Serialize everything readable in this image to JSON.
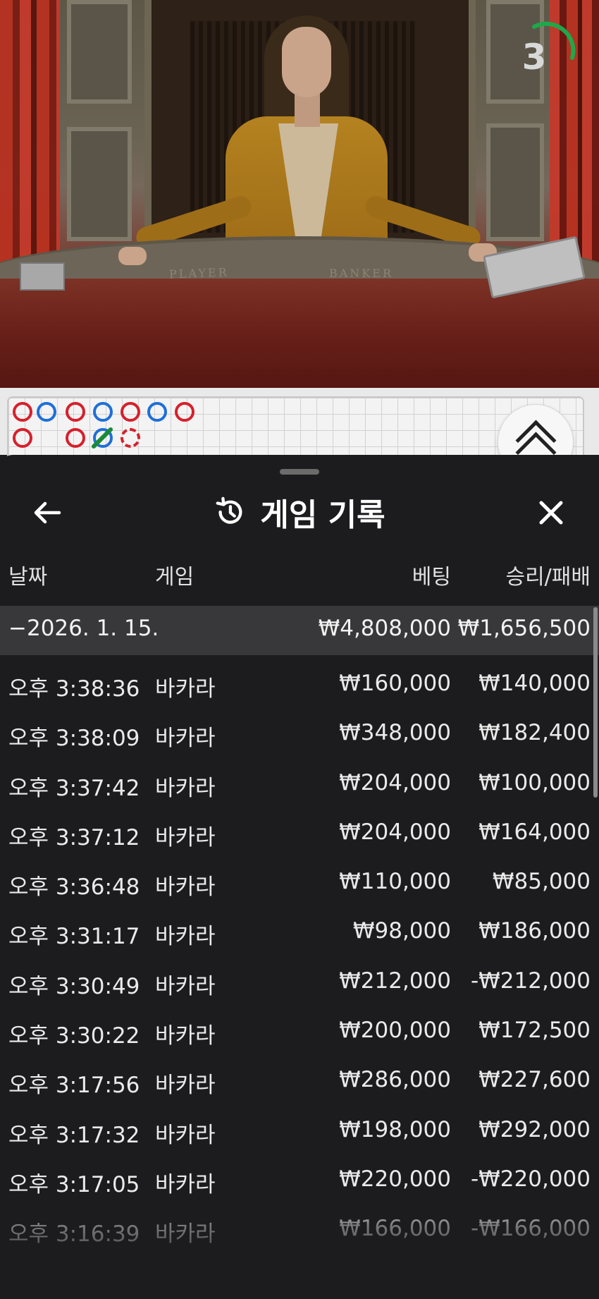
{
  "video": {
    "countdown": "3",
    "table_labels": {
      "player": "PLAYER",
      "banker": "BANKER"
    }
  },
  "roadmap": {
    "expand_icon": "chevron-double-up-icon"
  },
  "sheet": {
    "title": "게임 기록",
    "title_icon": "history-icon",
    "back_icon": "arrow-left-icon",
    "close_icon": "close-icon",
    "columns": {
      "date": "날짜",
      "game": "게임",
      "bet": "베팅",
      "winloss": "승리/패배"
    },
    "day_group": {
      "date": "−2026. 1. 15.",
      "bet_total": "₩4,808,000",
      "winloss_total": "₩1,656,500"
    },
    "rows": [
      {
        "time": "오후 3:38:36",
        "game": "바카라",
        "bet": "₩160,000",
        "winloss": "₩140,000"
      },
      {
        "time": "오후 3:38:09",
        "game": "바카라",
        "bet": "₩348,000",
        "winloss": "₩182,400"
      },
      {
        "time": "오후 3:37:42",
        "game": "바카라",
        "bet": "₩204,000",
        "winloss": "₩100,000"
      },
      {
        "time": "오후 3:37:12",
        "game": "바카라",
        "bet": "₩204,000",
        "winloss": "₩164,000"
      },
      {
        "time": "오후 3:36:48",
        "game": "바카라",
        "bet": "₩110,000",
        "winloss": "₩85,000"
      },
      {
        "time": "오후 3:31:17",
        "game": "바카라",
        "bet": "₩98,000",
        "winloss": "₩186,000"
      },
      {
        "time": "오후 3:30:49",
        "game": "바카라",
        "bet": "₩212,000",
        "winloss": "-₩212,000"
      },
      {
        "time": "오후 3:30:22",
        "game": "바카라",
        "bet": "₩200,000",
        "winloss": "₩172,500"
      },
      {
        "time": "오후 3:17:56",
        "game": "바카라",
        "bet": "₩286,000",
        "winloss": "₩227,600"
      },
      {
        "time": "오후 3:17:32",
        "game": "바카라",
        "bet": "₩198,000",
        "winloss": "₩292,000"
      },
      {
        "time": "오후 3:17:05",
        "game": "바카라",
        "bet": "₩220,000",
        "winloss": "-₩220,000"
      },
      {
        "time": "오후 3:16:39",
        "game": "바카라",
        "bet": "₩166,000",
        "winloss": "-₩166,000"
      }
    ]
  },
  "colors": {
    "banker_red": "#d6202b",
    "player_blue": "#1e6fd8",
    "tie_green": "#1a8a3a",
    "timer_green": "#1ea84a",
    "sheet_bg": "#1c1c1e",
    "day_row_bg": "#38383a"
  }
}
